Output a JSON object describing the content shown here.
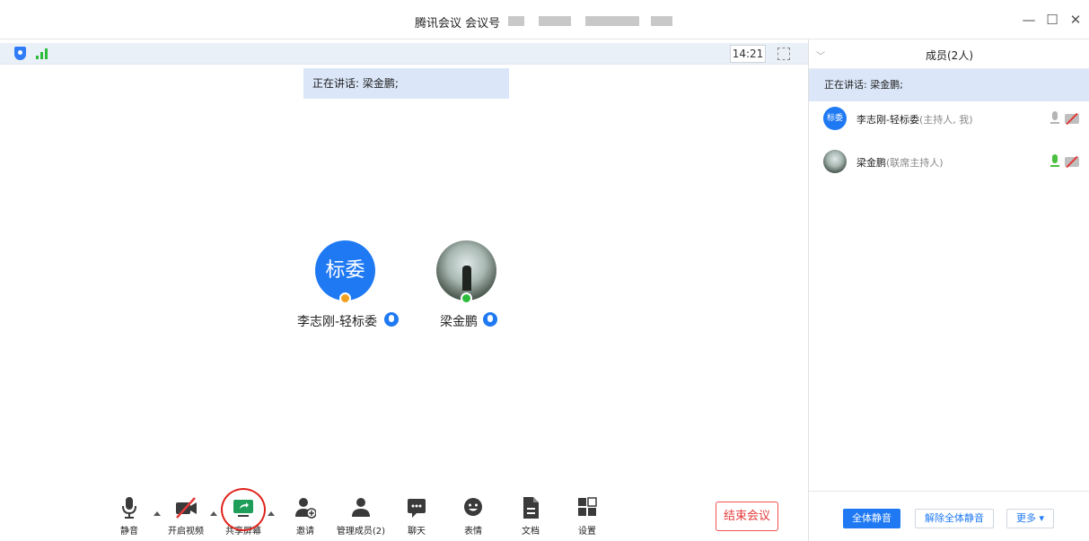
{
  "window": {
    "title": "腾讯会议 会议号",
    "minimize": "—",
    "maximize": "☐",
    "close": "✕"
  },
  "video": {
    "time": "14:21",
    "speaking_banner": "正在讲话: 梁金鹏;",
    "participants": [
      {
        "name": "李志刚-轻标委",
        "avatar_text": "标委",
        "avatar_color": "#1f79f3",
        "host_badge_color": "#f0a020"
      },
      {
        "name": "梁金鹏",
        "avatar_text": "",
        "host_badge_color": "#2dbb3b"
      }
    ]
  },
  "toolbar": {
    "items": [
      {
        "label": "静音",
        "icon": "microphone-icon"
      },
      {
        "label": "开启视频",
        "icon": "camera-off-icon"
      },
      {
        "label": "共享屏幕",
        "icon": "share-screen-icon"
      },
      {
        "label": "邀请",
        "icon": "invite-icon"
      },
      {
        "label": "管理成员(2)",
        "icon": "members-icon"
      },
      {
        "label": "聊天",
        "icon": "chat-icon"
      },
      {
        "label": "表情",
        "icon": "emoji-icon"
      },
      {
        "label": "文档",
        "icon": "document-icon"
      },
      {
        "label": "设置",
        "icon": "settings-icon"
      }
    ],
    "end_meeting": "结束会议"
  },
  "panel": {
    "title": "成员(2人)",
    "speaking": "正在讲话: 梁金鹏;",
    "members": [
      {
        "name": "李志刚-轻标委",
        "role": "(主持人, 我)",
        "avatar_text": "标委",
        "mic_state": "idle"
      },
      {
        "name": "梁金鹏",
        "role": "(联席主持人)",
        "avatar_text": "",
        "mic_state": "speaking"
      }
    ],
    "mute_all": "全体静音",
    "unmute_all": "解除全体静音",
    "more": "更多 ▾"
  },
  "colors": {
    "accent": "#1f79f3",
    "danger": "#e53a3a",
    "speaking_bg": "#dbe7f9",
    "annotation_circle": "#e0231c"
  }
}
